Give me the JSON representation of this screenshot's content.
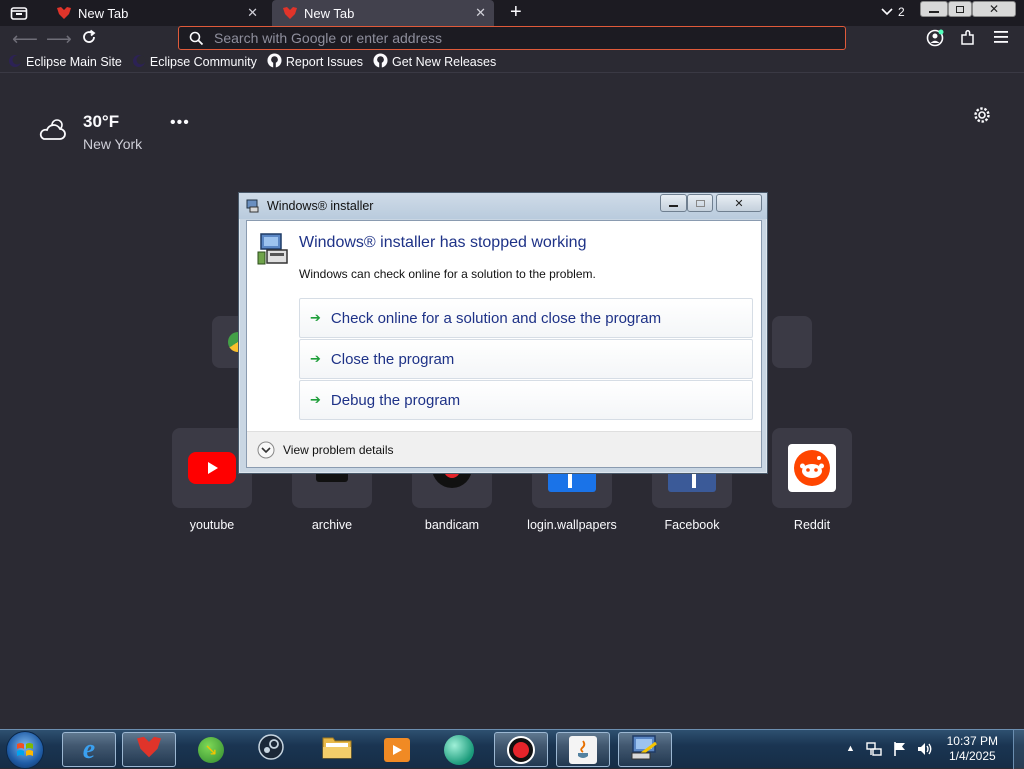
{
  "browser": {
    "tabs": [
      {
        "label": "New Tab",
        "active": false
      },
      {
        "label": "New Tab",
        "active": true
      }
    ],
    "tab_count": "2",
    "address_placeholder": "Search with Google or enter address",
    "bookmarks": [
      {
        "label": "Eclipse Main Site",
        "icon": "eclipse-icon"
      },
      {
        "label": "Eclipse Community",
        "icon": "eclipse-icon"
      },
      {
        "label": "Report Issues",
        "icon": "github-icon"
      },
      {
        "label": "Get New Releases",
        "icon": "github-icon"
      }
    ]
  },
  "weather": {
    "temp": "30°F",
    "city": "New York"
  },
  "shortcuts": [
    {
      "label": "youtube",
      "icon": "youtube-icon"
    },
    {
      "label": "archive",
      "icon": "archive-icon"
    },
    {
      "label": "bandicam",
      "icon": "bandicam-icon"
    },
    {
      "label": "login.wallpapers",
      "icon": "wallpapers-icon"
    },
    {
      "label": "Facebook",
      "icon": "facebook-icon"
    },
    {
      "label": "Reddit",
      "icon": "reddit-icon"
    }
  ],
  "dialog": {
    "title": "Windows® installer",
    "heading": "Windows® installer has stopped working",
    "subtext": "Windows can check online for a solution to the problem.",
    "options": [
      "Check online for a solution and close the program",
      "Close the program",
      "Debug the program"
    ],
    "details": "View problem details"
  },
  "taskbar": {
    "time": "10:37 PM",
    "date": "1/4/2025"
  },
  "colors": {
    "accent": "#e05a3a",
    "page_bg": "#2b2a33",
    "dialog_link": "#1e3287"
  }
}
